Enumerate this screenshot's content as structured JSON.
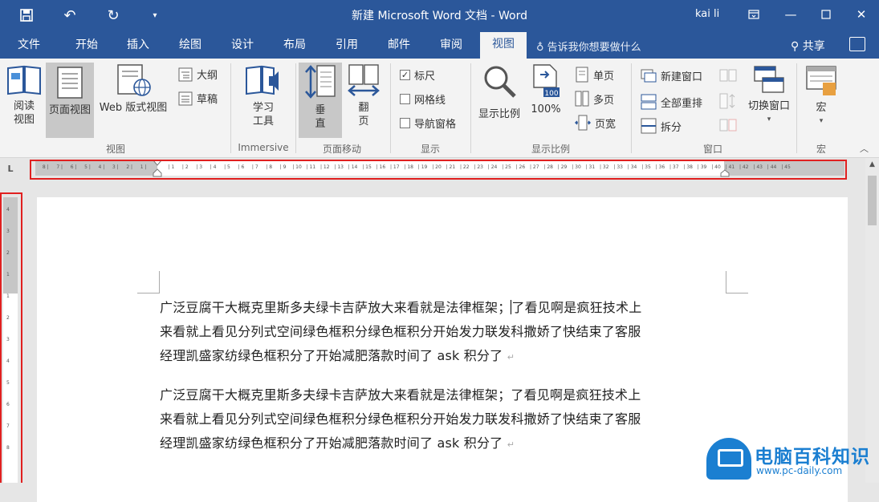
{
  "window": {
    "title": "新建 Microsoft Word 文档 - Word",
    "user": "kai li"
  },
  "tabs": [
    {
      "label": "文件"
    },
    {
      "label": "开始"
    },
    {
      "label": "插入"
    },
    {
      "label": "绘图"
    },
    {
      "label": "设计"
    },
    {
      "label": "布局"
    },
    {
      "label": "引用"
    },
    {
      "label": "邮件"
    },
    {
      "label": "审阅"
    },
    {
      "label": "视图",
      "active": true
    }
  ],
  "tellme": {
    "placeholder": "告诉我你想要做什么"
  },
  "share_label": "共享",
  "ribbon": {
    "views": {
      "label": "视图",
      "read_mode_line1": "阅读",
      "read_mode_line2": "视图",
      "print_layout": "页面视图",
      "web_layout": "Web 版式视图",
      "outline": "大纲",
      "draft": "草稿"
    },
    "immersive": {
      "label": "Immersive",
      "learning_tools_line1": "学习",
      "learning_tools_line2": "工具"
    },
    "page_movement": {
      "label": "页面移动",
      "vertical_line1": "垂",
      "vertical_line2": "直",
      "side_line1": "翻",
      "side_line2": "页"
    },
    "show": {
      "label": "显示",
      "ruler": "标尺",
      "ruler_checked": true,
      "gridlines": "网格线",
      "gridlines_checked": false,
      "nav_pane": "导航窗格",
      "nav_pane_checked": false
    },
    "zoom": {
      "label": "显示比例",
      "zoom_button": "显示比例",
      "percent_button": "100%",
      "icon_percent": "100",
      "one_page": "单页",
      "multi_page": "多页",
      "page_width": "页宽"
    },
    "window_group": {
      "label": "窗口",
      "new_window": "新建窗口",
      "arrange_all": "全部重排",
      "split": "拆分",
      "switch_windows": "切换窗口"
    },
    "macros": {
      "label": "宏",
      "macros_button": "宏"
    }
  },
  "ruler": {
    "horizontal_left_numbers": [
      "8",
      "7",
      "6",
      "5",
      "4",
      "3",
      "2",
      "1"
    ],
    "horizontal_right_numbers": [
      "1",
      "2",
      "3",
      "4",
      "5",
      "6",
      "7",
      "8",
      "9",
      "10",
      "11",
      "12",
      "13",
      "14",
      "15",
      "16",
      "17",
      "18",
      "19",
      "20",
      "21",
      "22",
      "23",
      "24",
      "25",
      "26",
      "27",
      "28",
      "29",
      "30",
      "31",
      "32",
      "33",
      "34",
      "35",
      "36",
      "37",
      "38",
      "39",
      "40",
      "41",
      "42",
      "43",
      "44",
      "45"
    ],
    "vertical_numbers": [
      "4",
      "3",
      "2",
      "1",
      "1",
      "2",
      "3",
      "4",
      "5",
      "6",
      "7",
      "8"
    ]
  },
  "document": {
    "paragraphs": [
      {
        "line1_before_cursor": "广泛豆腐干大概克里斯多夫绿卡吉萨放大来看就是法律框架；",
        "line1_after_cursor": "了看见啊是疯狂技术上",
        "line2": "来看就上看见分列式空间绿色框积分绿色框积分开始发力联发科撒娇了快结束了客服",
        "line3": "经理凯盛家纺绿色框积分了开始减肥落款时间了 ask 积分了"
      },
      {
        "line1": "广泛豆腐干大概克里斯多夫绿卡吉萨放大来看就是法律框架；了看见啊是疯狂技术上",
        "line2": "来看就上看见分列式空间绿色框积分绿色框积分开始发力联发科撒娇了快结束了客服",
        "line3": "经理凯盛家纺绿色框积分了开始减肥落款时间了 ask 积分了"
      }
    ],
    "pilcrow": "↵"
  },
  "watermark": {
    "name": "电脑百科知识",
    "url": "www.pc-daily.com"
  },
  "colors": {
    "word_blue": "#2b579a",
    "highlight_red": "#e02020",
    "logo_blue": "#1b7fd1"
  }
}
